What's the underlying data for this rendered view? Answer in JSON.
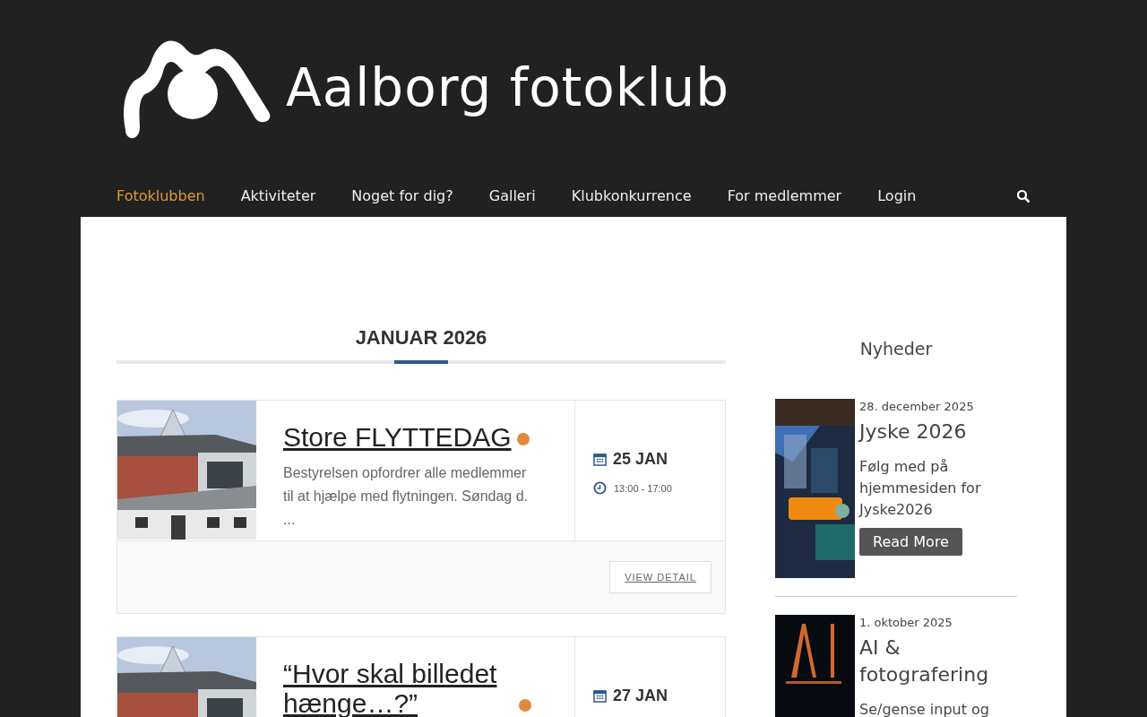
{
  "site": {
    "logo_text": "Aalborg fotoklub"
  },
  "nav": {
    "items": [
      {
        "label": "Fotoklubben",
        "selected": true
      },
      {
        "label": "Aktiviteter",
        "selected": false
      },
      {
        "label": "Noget for dig?",
        "selected": false
      },
      {
        "label": "Galleri",
        "selected": false
      },
      {
        "label": "Klubkonkurrence",
        "selected": false
      },
      {
        "label": "For medlemmer",
        "selected": false
      },
      {
        "label": "Login",
        "selected": false
      }
    ]
  },
  "calendar": {
    "month": "JANUAR 2026",
    "events": [
      {
        "title": "Store FLYTTEDAG",
        "color": "#e08a3c",
        "excerpt": "Bestyrelsen opfordrer alle medlemmer til at hjælpe med flytningen. Søndag d. ...",
        "date": "25 JAN",
        "time": "13:00 - 17:00",
        "button": "VIEW DETAIL"
      },
      {
        "title": "“Hvor skal billedet hænge…?”",
        "color": "#e08a3c",
        "date": "27 JAN"
      }
    ]
  },
  "sidebar": {
    "title": "Nyheder",
    "posts": [
      {
        "date": "28. december 2025",
        "title": "Jyske 2026",
        "excerpt": "Følg med på hjemmesiden for Jyske2026",
        "button": "Read More"
      },
      {
        "date": "1. oktober 2025",
        "title": "AI & fotografering",
        "excerpt": "Se/gense input og"
      }
    ]
  }
}
